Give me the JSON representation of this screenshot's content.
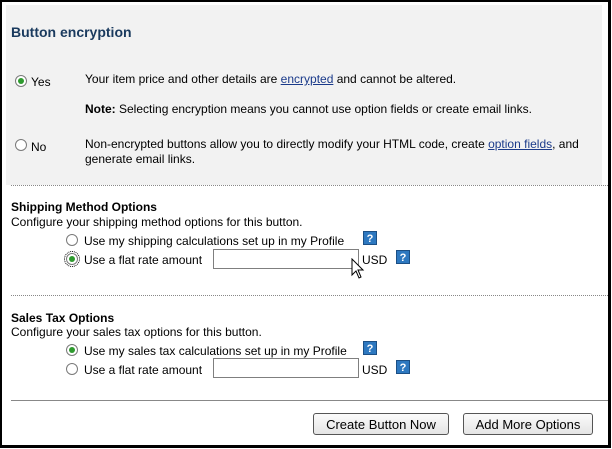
{
  "encryption": {
    "title": "Button encryption",
    "yes_label": "Yes",
    "yes_desc_before": "Your item price and other details are ",
    "yes_desc_link": "encrypted",
    "yes_desc_after": " and cannot be altered.",
    "note_bold": "Note:",
    "note_text": " Selecting encryption means you cannot use option fields or create email links.",
    "no_label": "No",
    "no_desc_before": "Non-encrypted buttons allow you to directly modify your HTML code, create ",
    "no_desc_link": "option fields",
    "no_desc_after": ", and",
    "no_desc_line2": "generate email links."
  },
  "shipping": {
    "heading": "Shipping Method Options",
    "subtext": "Configure your shipping method options for this button.",
    "option1": "Use my shipping calculations set up in my Profile",
    "option2": "Use a flat rate amount",
    "currency": "USD",
    "amount_value": ""
  },
  "tax": {
    "heading": "Sales Tax Options",
    "subtext": "Configure your sales tax options for this button.",
    "option1": "Use my sales tax calculations set up in my Profile",
    "option2": "Use a flat rate amount",
    "currency": "USD",
    "amount_value": ""
  },
  "buttons": {
    "create": "Create Button Now",
    "more": "Add More Options"
  },
  "icons": {
    "help": "?"
  },
  "colors": {
    "title": "#1a3a5e",
    "link": "#1a3a8a",
    "help_icon": "#2d78c0",
    "radio_selected": "#2e9a2e"
  }
}
